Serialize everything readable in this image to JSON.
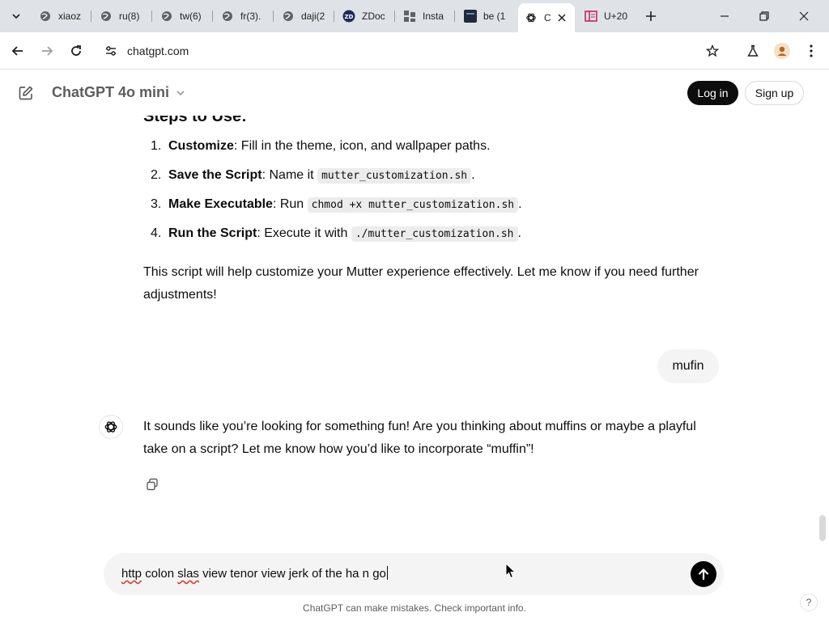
{
  "browser": {
    "tabs": [
      {
        "title": "xiaoz",
        "icon": "globe-icon"
      },
      {
        "title": "ru(8)",
        "icon": "globe-icon"
      },
      {
        "title": "tw(6)",
        "icon": "globe-icon"
      },
      {
        "title": "fr(3).",
        "icon": "globe-icon"
      },
      {
        "title": "daji(2",
        "icon": "globe-icon"
      },
      {
        "title": "ZDoc",
        "icon": "zdoc-icon"
      },
      {
        "title": "Insta",
        "icon": "puzzle-icon"
      },
      {
        "title": "be (1",
        "icon": "dark-square-icon"
      },
      {
        "title": "C",
        "icon": "openai-icon",
        "active": true
      },
      {
        "title": "U+20",
        "icon": "book-icon"
      }
    ],
    "url": "chatgpt.com"
  },
  "header": {
    "model_name": "ChatGPT 4o mini",
    "login_label": "Log in",
    "signup_label": "Sign up"
  },
  "conversation": {
    "steps_heading": "Steps to Use:",
    "steps": [
      {
        "num": "1.",
        "bold": "Customize",
        "text": ": Fill in the theme, icon, and wallpaper paths.",
        "code": "",
        "tail": ""
      },
      {
        "num": "2.",
        "bold": "Save the Script",
        "text": ": Name it ",
        "code": "mutter_customization.sh",
        "tail": "."
      },
      {
        "num": "3.",
        "bold": "Make Executable",
        "text": ": Run ",
        "code": "chmod +x mutter_customization.sh",
        "tail": "."
      },
      {
        "num": "4.",
        "bold": "Run the Script",
        "text": ": Execute it with ",
        "code": "./mutter_customization.sh",
        "tail": "."
      }
    ],
    "closing_paragraph": "This script will help customize your Mutter experience effectively. Let me know if you need further adjustments!",
    "user_message": "mufin",
    "assistant_reply": "It sounds like you’re looking for something fun! Are you thinking about muffins or maybe a playful take on a script? Let me know how you’d like to incorporate “muffin”!"
  },
  "composer": {
    "input_before": "http",
    "input_mid1": " colon ",
    "input_misspelled": "slas",
    "input_after": " view tenor view jerk of the ha n go"
  },
  "footer": {
    "disclaimer": "ChatGPT can make mistakes. Check important info.",
    "help_label": "?"
  },
  "colors": {
    "accent_black": "#0d0d0d",
    "bubble_gray": "#f4f4f4",
    "tabstrip": "#dfe3e8"
  }
}
